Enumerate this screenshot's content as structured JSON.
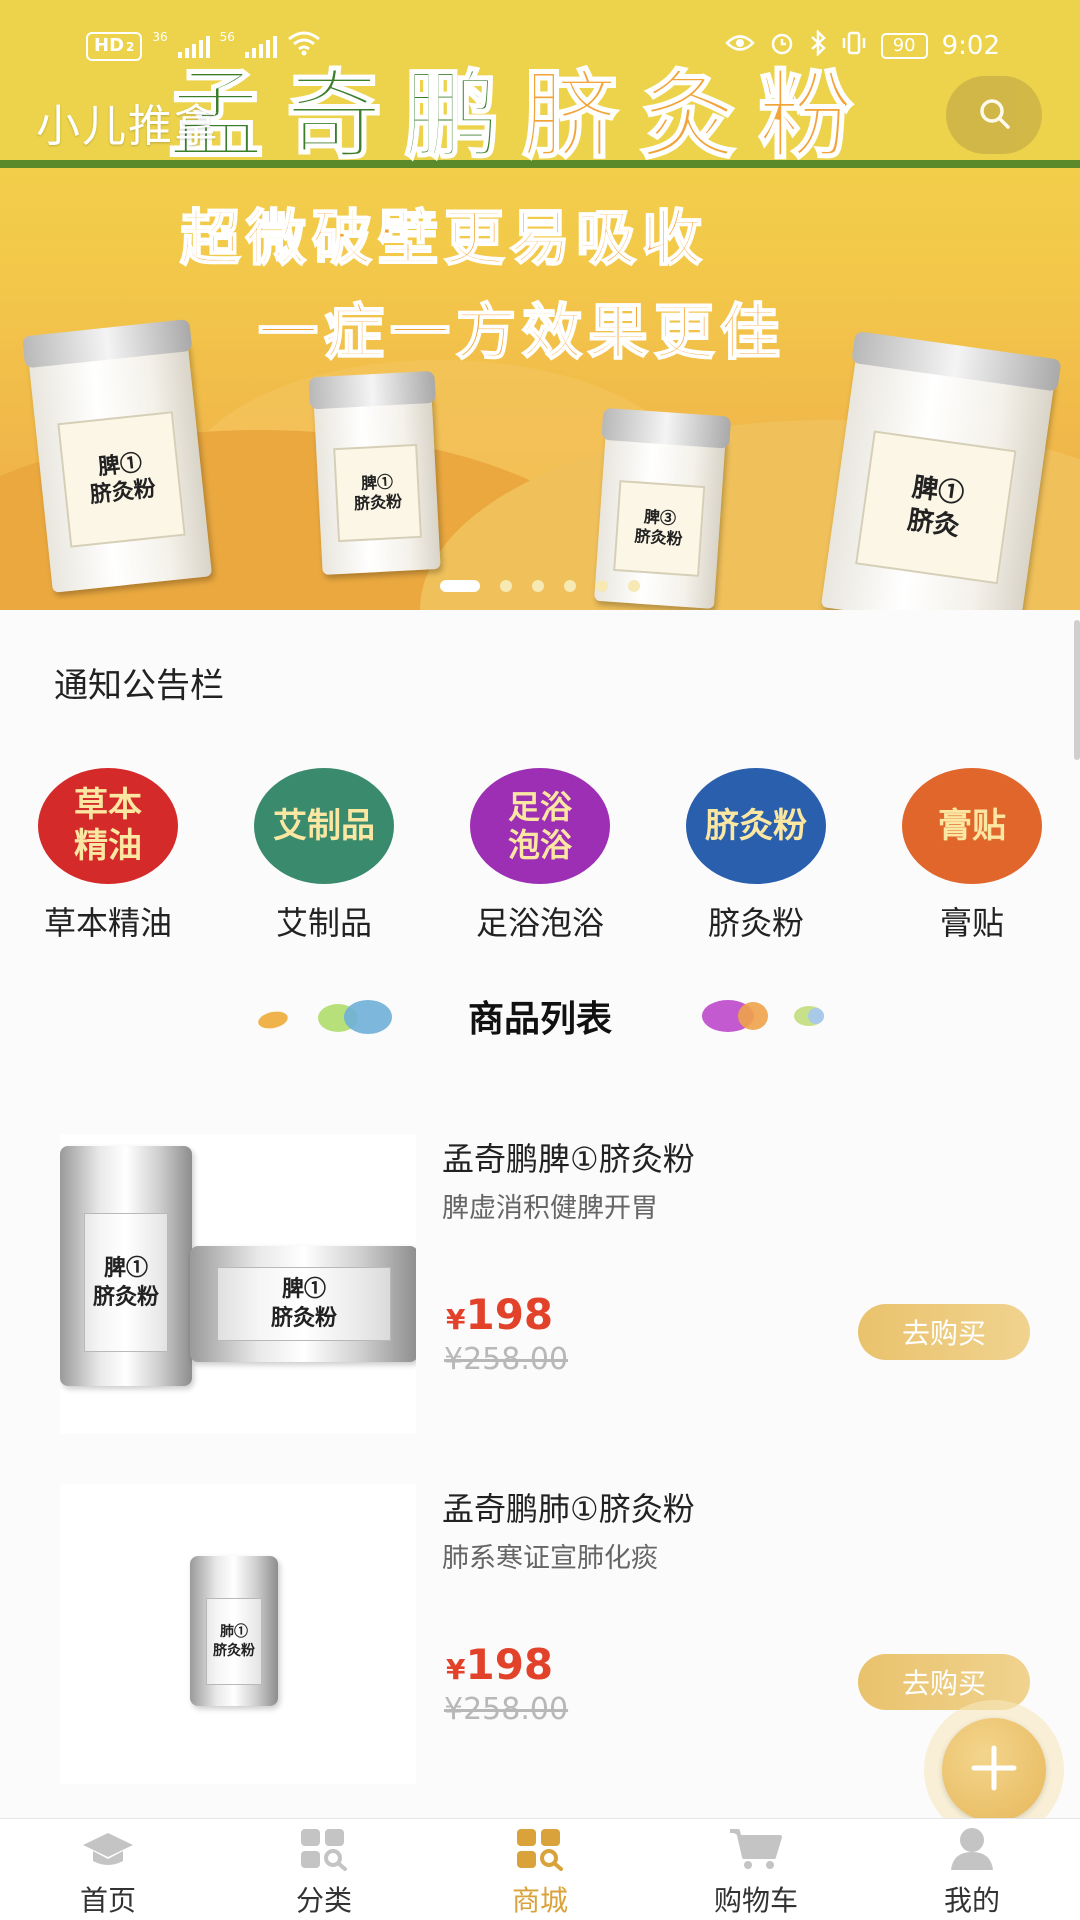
{
  "status_bar": {
    "network_chip": "HD",
    "sim": "2",
    "signal1": "36",
    "signal2": "56",
    "battery": "90",
    "time": "9:02"
  },
  "header": {
    "app_title": "小儿推拿",
    "search_icon": "search-icon"
  },
  "banner": {
    "brand_part1": "孟奇鹏",
    "brand_part2": "脐灸粉",
    "slogan_line1": "超微破壁更易吸收",
    "slogan_line2": "一症一方效果更佳",
    "cans": [
      {
        "line1": "脾①",
        "line2": "脐灸粉"
      },
      {
        "line1": "脾①",
        "line2": "脐灸粉"
      },
      {
        "line1": "脾③",
        "line2": "脐灸粉"
      },
      {
        "line1": "脾①",
        "line2": "脐灸"
      }
    ],
    "slide_count": 6,
    "active_slide": 1
  },
  "notice": {
    "title": "通知公告栏"
  },
  "categories": [
    {
      "circle_text": "草本\n精油",
      "label": "草本精油",
      "color": "#d42a2a"
    },
    {
      "circle_text": "艾制品",
      "label": "艾制品",
      "color": "#3a8a6e"
    },
    {
      "circle_text": "足浴\n泡浴",
      "label": "足浴泡浴",
      "color": "#9d2fb5"
    },
    {
      "circle_text": "脐灸粉",
      "label": "脐灸粉",
      "color": "#2a5fae"
    },
    {
      "circle_text": "膏贴",
      "label": "膏贴",
      "color": "#e0662c"
    }
  ],
  "section": {
    "title": "商品列表"
  },
  "products": [
    {
      "name": "孟奇鹏脾①脐灸粉",
      "desc": "脾虚消积健脾开胃",
      "price_symbol": "¥",
      "price": "198",
      "old_price": "¥258.00",
      "buy_label": "去购买",
      "image_label1": "脾①",
      "image_label2": "脐灸粉"
    },
    {
      "name": "孟奇鹏肺①脐灸粉",
      "desc": "肺系寒证宣肺化痰",
      "price_symbol": "¥",
      "price": "198",
      "old_price": "¥258.00",
      "buy_label": "去购买",
      "image_label1": "肺①",
      "image_label2": "脐灸粉"
    }
  ],
  "fab": {
    "icon": "plus-icon"
  },
  "tabbar": {
    "items": [
      {
        "label": "首页",
        "icon": "graduation-cap-icon"
      },
      {
        "label": "分类",
        "icon": "category-grid-icon"
      },
      {
        "label": "商城",
        "icon": "mall-grid-icon"
      },
      {
        "label": "购物车",
        "icon": "cart-icon"
      },
      {
        "label": "我的",
        "icon": "user-icon"
      }
    ],
    "active_index": 2,
    "active_color": "#d9a23a",
    "inactive_color": "#c4c4c4"
  }
}
